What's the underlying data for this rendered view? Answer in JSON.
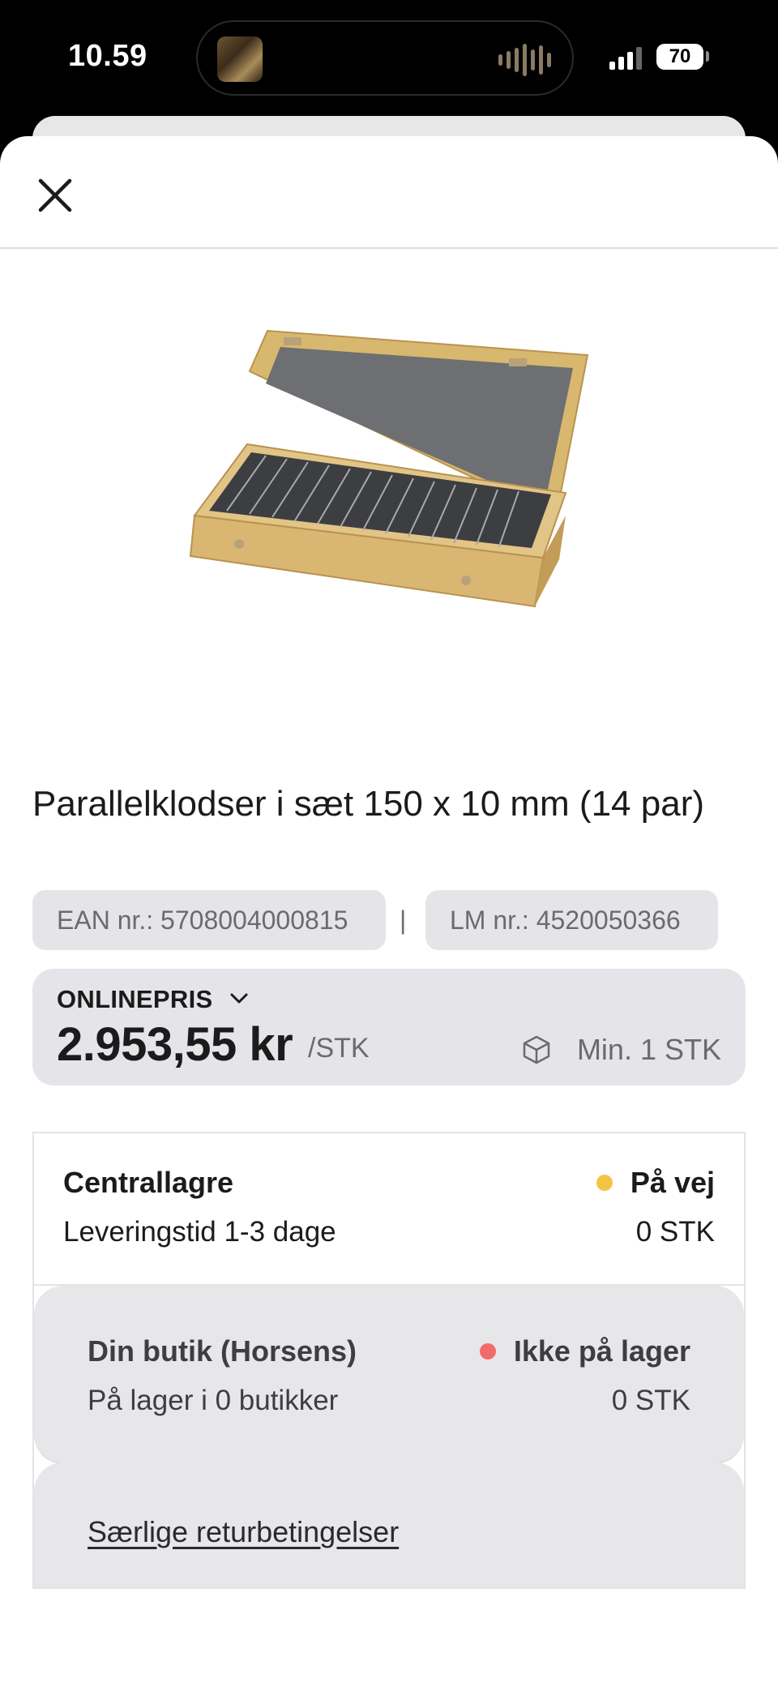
{
  "status_bar": {
    "time": "10.59",
    "battery": "70"
  },
  "product": {
    "title": "Parallelklodser i sæt 150 x 10 mm (14 par)",
    "ean": "EAN nr.: 5708004000815",
    "separator": "|",
    "lm": "LM nr.: 4520050366"
  },
  "price": {
    "label": "ONLINEPRIS",
    "value": "2.953,55 kr",
    "unit": "/STK",
    "min_qty": "Min. 1 STK"
  },
  "stock": {
    "central": {
      "title": "Centrallagre",
      "subtitle": "Leveringstid 1-3 dage",
      "status": "På vej",
      "status_color": "#f4c542",
      "qty": "0 STK"
    },
    "store": {
      "title": "Din butik (Horsens)",
      "subtitle": "På lager i 0 butikker",
      "status": "Ikke på lager",
      "status_color": "#f26b6b",
      "qty": "0 STK"
    },
    "return_link": "Særlige returbetingelser"
  },
  "icons": {
    "close": "close-icon",
    "chevron": "chevron-down-icon",
    "package": "package-icon"
  }
}
